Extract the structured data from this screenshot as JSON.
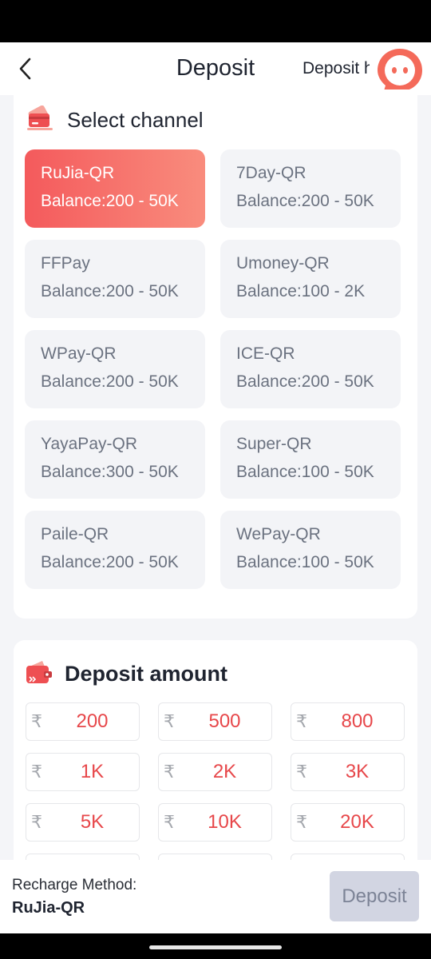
{
  "header": {
    "title": "Deposit",
    "history_label": "Deposit history"
  },
  "channel_section": {
    "label": "Select channel",
    "channels": [
      {
        "name": "RuJia-QR",
        "balance": "Balance:200 - 50K",
        "active": true
      },
      {
        "name": "7Day-QR",
        "balance": "Balance:200 - 50K",
        "active": false
      },
      {
        "name": "FFPay",
        "balance": "Balance:200 - 50K",
        "active": false
      },
      {
        "name": "Umoney-QR",
        "balance": "Balance:100 - 2K",
        "active": false
      },
      {
        "name": "WPay-QR",
        "balance": "Balance:200 - 50K",
        "active": false
      },
      {
        "name": "ICE-QR",
        "balance": "Balance:200 - 50K",
        "active": false
      },
      {
        "name": "YayaPay-QR",
        "balance": "Balance:300 - 50K",
        "active": false
      },
      {
        "name": "Super-QR",
        "balance": "Balance:100 - 50K",
        "active": false
      },
      {
        "name": "Paile-QR",
        "balance": "Balance:200 - 50K",
        "active": false
      },
      {
        "name": "WePay-QR",
        "balance": "Balance:100 - 50K",
        "active": false
      }
    ]
  },
  "amount_section": {
    "label": "Deposit amount",
    "currency_symbol": "₹",
    "amounts": [
      "200",
      "500",
      "800",
      "1K",
      "2K",
      "3K",
      "5K",
      "10K",
      "20K"
    ]
  },
  "footer": {
    "method_label": "Recharge Method:",
    "method_value": "RuJia-QR",
    "deposit_button": "Deposit"
  },
  "icons": {
    "back": "chevron-left-icon",
    "support": "chat-support-icon",
    "channel": "card-icon",
    "amount": "wallet-icon"
  },
  "colors": {
    "accent": "#f45a5c",
    "amount_text": "#e7474a",
    "button_disabled": "#d2d5e2"
  }
}
